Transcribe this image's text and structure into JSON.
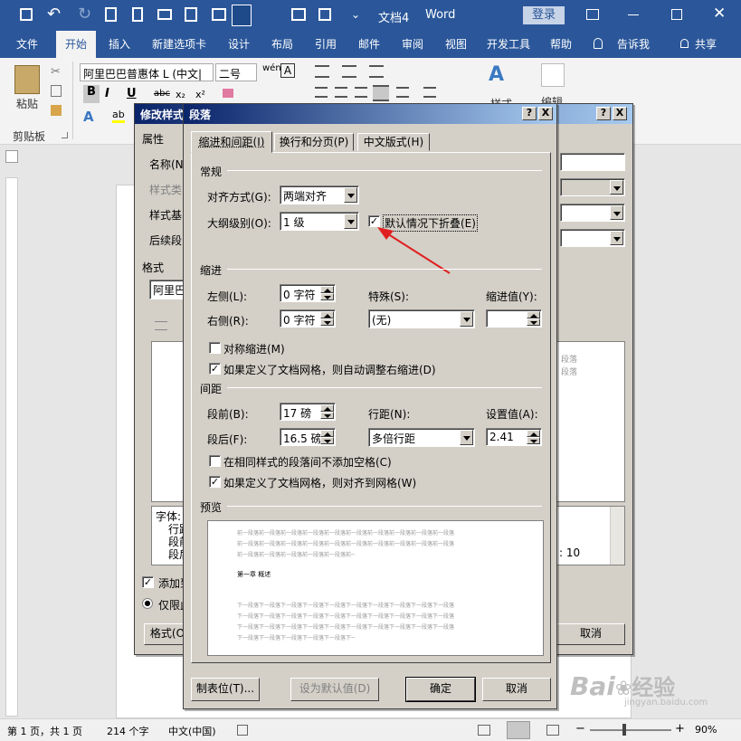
{
  "window": {
    "doc_title": "文档4",
    "app_name": "Word",
    "login_label": "登录"
  },
  "tabs": [
    {
      "label": "文件"
    },
    {
      "label": "开始"
    },
    {
      "label": "插入"
    },
    {
      "label": "新建选项卡"
    },
    {
      "label": "设计"
    },
    {
      "label": "布局"
    },
    {
      "label": "引用"
    },
    {
      "label": "邮件"
    },
    {
      "label": "审阅"
    },
    {
      "label": "视图"
    },
    {
      "label": "开发工具"
    },
    {
      "label": "帮助"
    },
    {
      "label": "告诉我"
    },
    {
      "label": "共享"
    }
  ],
  "ribbon": {
    "paste_label": "粘贴",
    "clipboard_group": "剪贴板",
    "font_name": "阿里巴巴普惠体 L (中文|",
    "font_size": "二号",
    "bold": "B",
    "italic": "I",
    "underline": "U",
    "styles_label": "样式",
    "edit_label": "编辑"
  },
  "modify_style": {
    "title": "修改样式",
    "section_props": "属性",
    "name_label": "名称(N",
    "style_type_label": "样式类",
    "style_based_label": "样式基",
    "follow_label": "后续段",
    "format_section": "格式",
    "font_preview": "阿里巴",
    "desc_line1": "字体: ",
    "desc_line2": "行距",
    "desc_line3": "段前",
    "desc_line4": "段后",
    "desc_right": ": 10",
    "preview_right1": "段落",
    "preview_right2": "段落",
    "add_label": "添加到",
    "only_label": "仅限此",
    "format_btn": "格式(O",
    "cancel_btn": "取消",
    "help_btn": "?",
    "close_btn": "X"
  },
  "paragraph": {
    "title": "段落",
    "help_btn": "?",
    "close_btn": "X",
    "tabs": [
      "缩进和间距(I)",
      "换行和分页(P)",
      "中文版式(H)"
    ],
    "general_section": "常规",
    "align_label": "对齐方式(G):",
    "align_value": "两端对齐",
    "outline_label": "大纲级别(O):",
    "outline_value": "1 级",
    "collapse_label": "默认情况下折叠(E)",
    "indent_section": "缩进",
    "left_label": "左侧(L):",
    "left_value": "0 字符",
    "right_label": "右侧(R):",
    "right_value": "0 字符",
    "special_label": "特殊(S):",
    "special_value": "(无)",
    "indent_by_label": "缩进值(Y):",
    "indent_by_value": "",
    "mirror_label": "对称缩进(M)",
    "auto_adjust_label": "如果定义了文档网格，则自动调整右缩进(D)",
    "spacing_section": "间距",
    "before_label": "段前(B):",
    "before_value": "17 磅",
    "after_label": "段后(F):",
    "after_value": "16.5 磅",
    "line_label": "行距(N):",
    "line_value": "多倍行距",
    "at_label": "设置值(A):",
    "at_value": "2.41",
    "no_space_label": "在相同样式的段落间不添加空格(C)",
    "snap_grid_label": "如果定义了文档网格，则对齐到网格(W)",
    "preview_section": "预览",
    "preview_prev": "前一段落前一段落前一段落前一段落前一段落前一段落前一段落前一段落前一段落前一段落",
    "preview_sample": "第一章 概述",
    "preview_next": "下一段落下一段落下一段落下一段落下一段落下一段落下一段落下一段落下一段落下一段落",
    "tabs_btn": "制表位(T)...",
    "default_btn": "设为默认值(D)",
    "ok_btn": "确定",
    "cancel_btn": "取消"
  },
  "status": {
    "page": "第 1 页，共 1 页",
    "words": "214 个字",
    "lang": "中文(中国)",
    "zoom": "90%"
  },
  "watermark": {
    "brand": "Bai",
    "brand2": "经验",
    "url": "jingyan.baidu.com"
  }
}
